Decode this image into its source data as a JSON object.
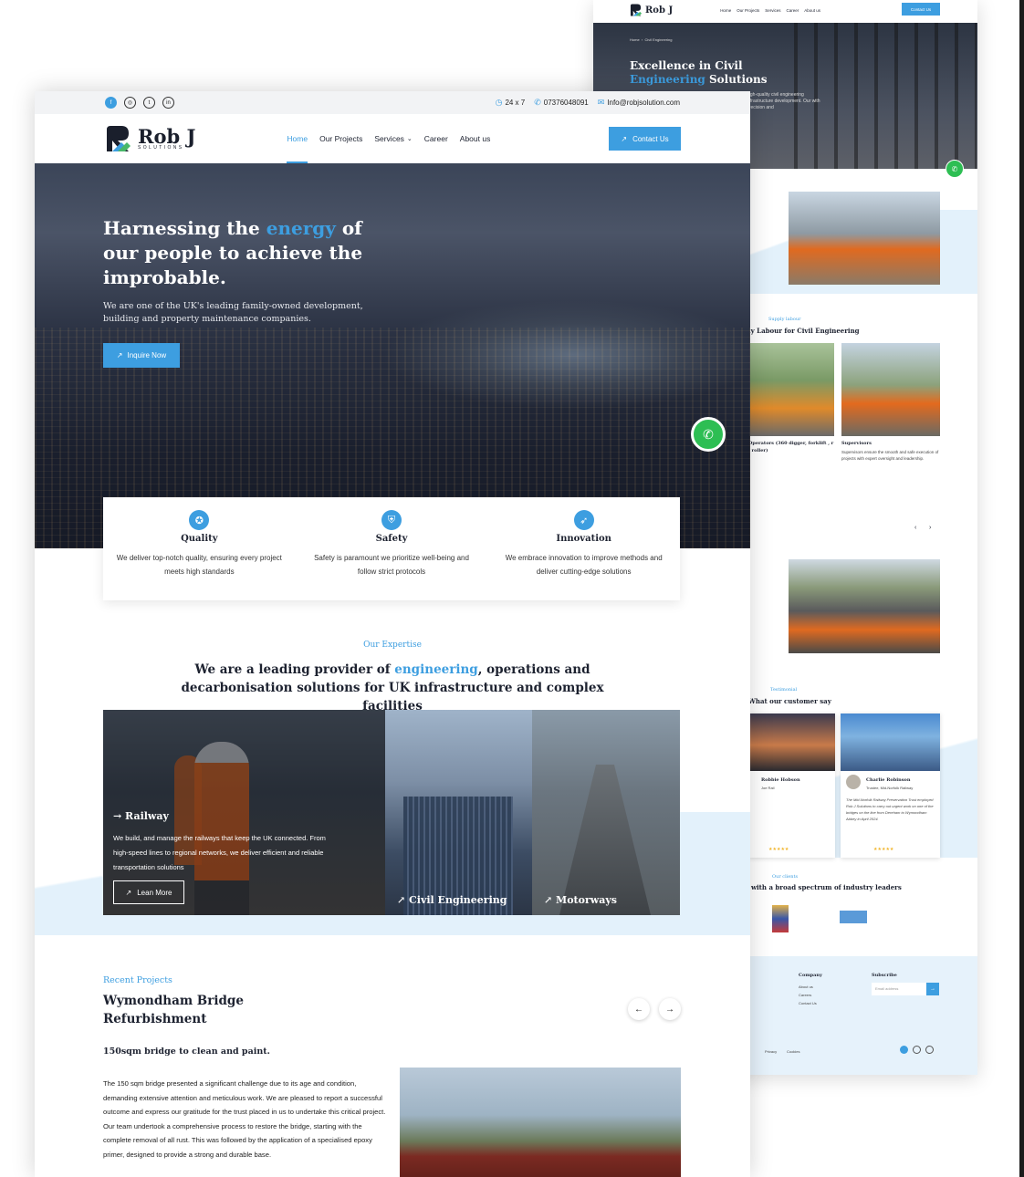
{
  "colors": {
    "accent": "#3d9ee0",
    "dark": "#1d2230",
    "whatsapp": "#2dbe53"
  },
  "topbar": {
    "social_icons": [
      "facebook-icon",
      "instagram-icon",
      "twitter-icon",
      "linkedin-icon"
    ],
    "social_glyphs": [
      "f",
      "◎",
      "t",
      "in"
    ],
    "hours": "24 x 7",
    "phone": "07376048091",
    "email": "Info@robjsolution.com"
  },
  "brand": {
    "name": "Rob J",
    "tagline": "SOLUTIONS"
  },
  "nav": {
    "items": [
      "Home",
      "Our Projects",
      "Services",
      "Career",
      "About us"
    ],
    "active": "Home",
    "contact_label": "Contact Us"
  },
  "hero": {
    "title_before": "Harnessing the ",
    "title_accent": "energy",
    "title_after": " of our people to achieve the improbable.",
    "subtitle": "We are one of the UK's leading family-owned development, building and property maintenance companies.",
    "cta": "Inquire Now"
  },
  "features": [
    {
      "icon": "quality-badge-icon",
      "title": "Quality",
      "text": "We deliver top-notch quality, ensuring every project meets high standards"
    },
    {
      "icon": "safety-shield-icon",
      "title": "Safety",
      "text": "Safety is paramount we prioritize well-being and follow strict protocols"
    },
    {
      "icon": "innovation-rocket-icon",
      "title": "Innovation",
      "text": "We embrace innovation to improve methods and deliver cutting-edge solutions"
    }
  ],
  "expertise": {
    "subtitle": "Our Expertise",
    "title_before": "We are a leading provider of ",
    "title_accent": "engineering",
    "title_after": ", operations and decarbonisation solutions for UK infrastructure and complex facilities",
    "cards": [
      {
        "title": "Railway",
        "text": "We build, and manage the railways that keep the UK connected. From high-speed lines to regional networks, we deliver efficient and reliable transportation solutions",
        "button": "Lean More"
      },
      {
        "title": "Civil Engineering"
      },
      {
        "title": "Motorways"
      }
    ]
  },
  "projects": {
    "subtitle": "Recent Projects",
    "title": "Wymondham Bridge Refurbishment",
    "heading": "150sqm bridge to clean and paint.",
    "para1": "The 150 sqm bridge presented a significant challenge due to its age and condition, demanding extensive attention and meticulous work. We are pleased to report a successful outcome and express our gratitude for the trust placed in us to undertake this critical project.",
    "para2": "Our team undertook a comprehensive process to restore the bridge, starting with the complete removal of all rust. This was followed by the application of a specialised epoxy primer, designed to provide a strong and durable base."
  },
  "background_page": {
    "nav_items": [
      "Home",
      "Our Projects",
      "Services",
      "Career",
      "About us"
    ],
    "contact_label": "Contact Us",
    "breadcrumb": [
      "Home",
      "Civil Engineering"
    ],
    "hero_title_before": "Excellence in Civil ",
    "hero_title_accent": "Engineering",
    "hero_title_after": " Solutions",
    "hero_text": "high-quality civil engineering infrastructure development. Our with precision and",
    "labour_sub": "Supply labour",
    "labour_title": "ly Labour for Civil Engineering",
    "operators_title": "Operators (360 digger, forklift , r , roller)",
    "supervisors_title": "Supervisors",
    "supervisors_text": "Supervisors ensure the smooth and safe execution of projects with expert oversight and leadership.",
    "testimonial_sub": "Testimonial",
    "testimonial_title": "What our customer say",
    "t1_name": "Robbie Hobson",
    "t1_role": "Joe Rail",
    "t2_name": "Charlie Robinson",
    "t2_role": "Trustee, Mid-Norfolk Railway",
    "t2_text": "The Mid-Norfolk Railway Preservation Trust employed Rob J Solutions to carry out urgent work on one of the bridges on the line from Dereham to Wymondham Abbey in April 2024.",
    "stars": "★★★★★",
    "clients_sub": "Our clients",
    "clients_title": "with a broad spectrum of industry leaders",
    "footer_company": "Company",
    "footer_links": [
      "About us",
      "Careers",
      "Contact Us"
    ],
    "footer_subscribe": "Subscribe",
    "email_placeholder": "Email address",
    "footer_bottom": [
      "Privacy",
      "Cookies"
    ]
  }
}
